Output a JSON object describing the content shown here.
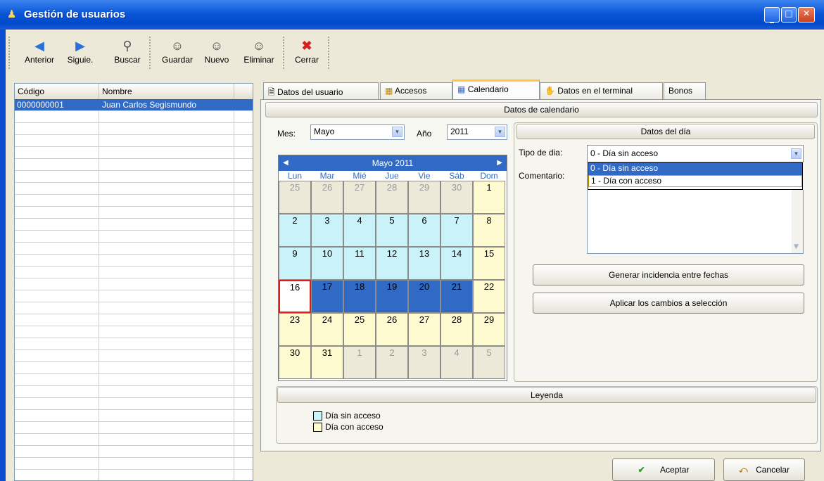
{
  "window": {
    "title": "Gestión de usuarios"
  },
  "toolbar": {
    "anterior": "Anterior",
    "siguiente": "Siguie.",
    "buscar": "Buscar",
    "guardar": "Guardar",
    "nuevo": "Nuevo",
    "eliminar": "Eliminar",
    "cerrar": "Cerrar"
  },
  "grid": {
    "columns": [
      "Código",
      "Nombre"
    ],
    "rows": [
      {
        "codigo": "0000000001",
        "nombre": "Juan Carlos Segismundo"
      }
    ]
  },
  "tabs": [
    "Datos del usuario",
    "Accesos",
    "Calendario",
    "Datos en el terminal",
    "Bonos"
  ],
  "calendario": {
    "section_title": "Datos de calendario",
    "mes_label": "Mes:",
    "mes_value": "Mayo",
    "anio_label": "Año",
    "anio_value": "2011",
    "month_header": "Mayo 2011",
    "weekdays": [
      "Lun",
      "Mar",
      "Mié",
      "Jue",
      "Vie",
      "Sáb",
      "Dom"
    ],
    "weeks": [
      [
        "25",
        "26",
        "27",
        "28",
        "29",
        "30",
        "1"
      ],
      [
        "2",
        "3",
        "4",
        "5",
        "6",
        "7",
        "8"
      ],
      [
        "9",
        "10",
        "11",
        "12",
        "13",
        "14",
        "15"
      ],
      [
        "16",
        "17",
        "18",
        "19",
        "20",
        "21",
        "22"
      ],
      [
        "23",
        "24",
        "25",
        "26",
        "27",
        "28",
        "29"
      ],
      [
        "30",
        "31",
        "1",
        "2",
        "3",
        "4",
        "5"
      ]
    ]
  },
  "datos_dia": {
    "title": "Datos del día",
    "tipo_label": "Tipo de dia:",
    "tipo_value": "0 - Día sin acceso",
    "options": [
      "0 - Día sin acceso",
      "1 - Día con acceso"
    ],
    "comentario_label": "Comentario:",
    "generar_button": "Generar incidencia entre fechas",
    "aplicar_button": "Aplicar los cambios a selección"
  },
  "leyenda": {
    "title": "Leyenda",
    "sin_acceso": "Día sin acceso",
    "con_acceso": "Día con acceso"
  },
  "footer": {
    "aceptar": "Aceptar",
    "cancelar": "Cancelar"
  },
  "colors": {
    "selection": "#316ac5",
    "sin_acceso": "#c9f3f9",
    "con_acceso": "#fffbd0",
    "today_border": "#e41a1a"
  }
}
